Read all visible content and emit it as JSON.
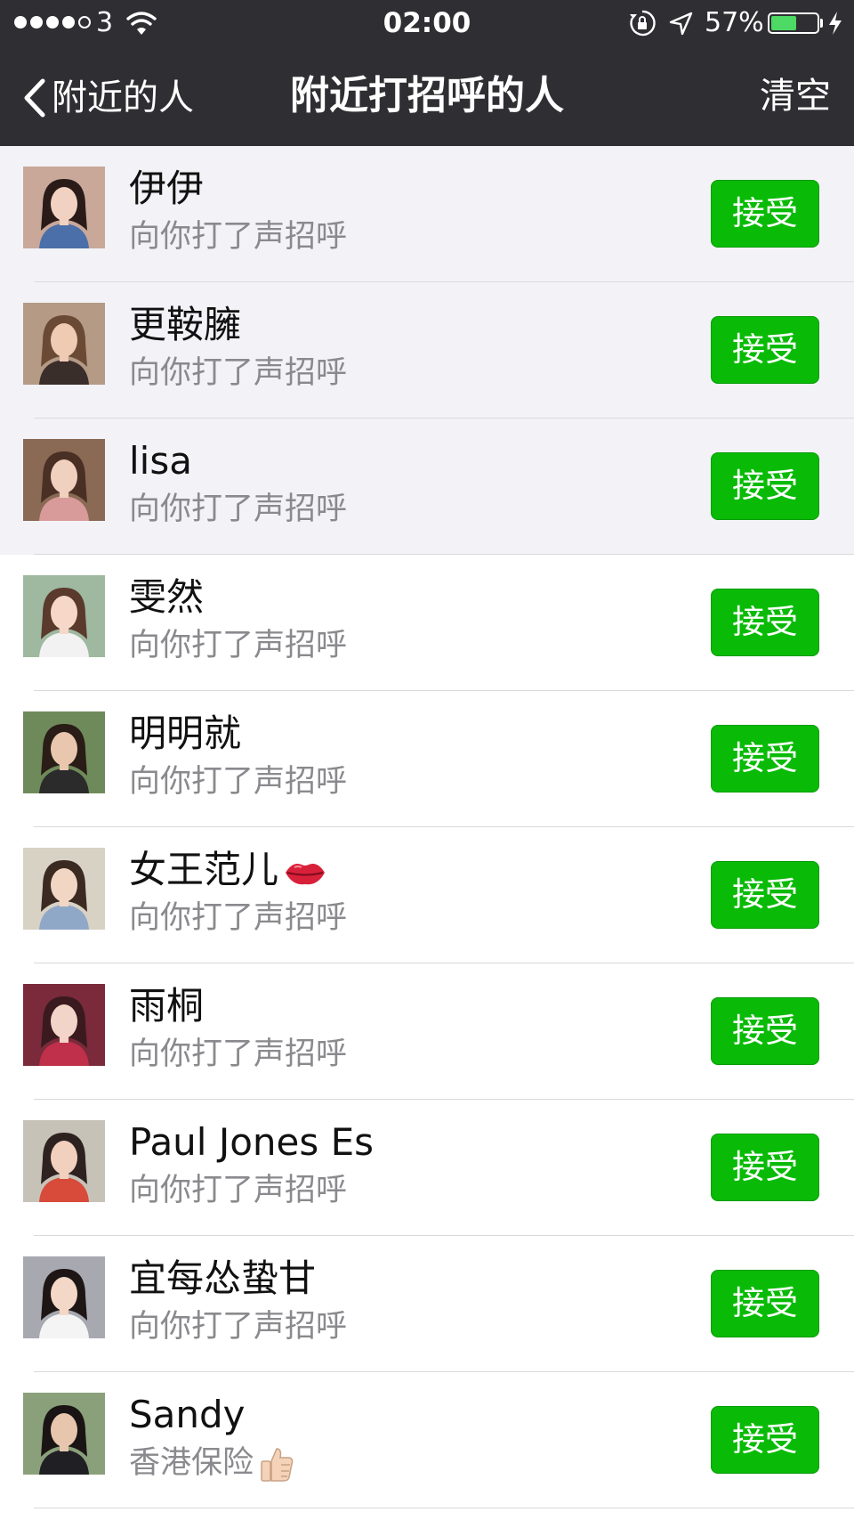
{
  "status_bar": {
    "carrier": "3",
    "time": "02:00",
    "battery_percent": "57%",
    "battery_level": 0.57,
    "signal_bars": 4,
    "signal_total": 5
  },
  "nav": {
    "back_label": "附近的人",
    "title": "附近打招呼的人",
    "clear_label": "清空"
  },
  "colors": {
    "accent_green": "#09bb07",
    "nav_bg": "#2f2f33",
    "unread_bg": "#f3f3f7"
  },
  "greetings": [
    {
      "name": "伊伊",
      "message": "向你打了声招呼",
      "accept": "接受",
      "unread": true,
      "avatar": {
        "bg": "#c9a89a",
        "skin": "#f1d2c2",
        "hair": "#2a1b18",
        "cloth": "#4b6fa8"
      }
    },
    {
      "name": "更鞍臃",
      "message": "向你打了声招呼",
      "accept": "接受",
      "unread": true,
      "avatar": {
        "bg": "#b59a86",
        "skin": "#efcbb4",
        "hair": "#6b4a35",
        "cloth": "#3a2e2a"
      }
    },
    {
      "name": "lisa",
      "message": "向你打了声招呼",
      "accept": "接受",
      "unread": true,
      "avatar": {
        "bg": "#8a6a55",
        "skin": "#f0d0be",
        "hair": "#4a3024",
        "cloth": "#d99a9a"
      }
    },
    {
      "name": "雯然",
      "message": "向你打了声招呼",
      "accept": "接受",
      "unread": false,
      "avatar": {
        "bg": "#9fb8a0",
        "skin": "#f5d8c8",
        "hair": "#5a3a2c",
        "cloth": "#f2f2f2"
      }
    },
    {
      "name": "明明就",
      "message": "向你打了声招呼",
      "accept": "接受",
      "unread": false,
      "avatar": {
        "bg": "#6f8a5a",
        "skin": "#e9c6ae",
        "hair": "#2a1c16",
        "cloth": "#2b2b2b"
      }
    },
    {
      "name": "女王范儿",
      "message": "向你打了声招呼",
      "accept": "接受",
      "unread": false,
      "emoji": "lips",
      "avatar": {
        "bg": "#d8d2c4",
        "skin": "#f2d6c4",
        "hair": "#3b2a22",
        "cloth": "#8fa8c8"
      }
    },
    {
      "name": "雨桐",
      "message": "向你打了声招呼",
      "accept": "接受",
      "unread": false,
      "avatar": {
        "bg": "#7a2a3a",
        "skin": "#f3d4c8",
        "hair": "#3a1a1e",
        "cloth": "#c0304a"
      }
    },
    {
      "name": "Paul Jones Es",
      "message": "向你打了声招呼",
      "accept": "接受",
      "unread": false,
      "avatar": {
        "bg": "#c7c2b8",
        "skin": "#f1d1be",
        "hair": "#2e2220",
        "cloth": "#d84a3a"
      }
    },
    {
      "name": "宜每怂蛰甘",
      "message": "向你打了声招呼",
      "accept": "接受",
      "unread": false,
      "avatar": {
        "bg": "#a8a8b0",
        "skin": "#f3d8c8",
        "hair": "#1e1614",
        "cloth": "#f4f4f4"
      }
    },
    {
      "name": "Sandy",
      "message": "香港保险",
      "accept": "接受",
      "unread": false,
      "msg_emoji": "thumbs-up",
      "avatar": {
        "bg": "#8aa07a",
        "skin": "#e8c6ae",
        "hair": "#1a1414",
        "cloth": "#1f1f24"
      }
    }
  ]
}
